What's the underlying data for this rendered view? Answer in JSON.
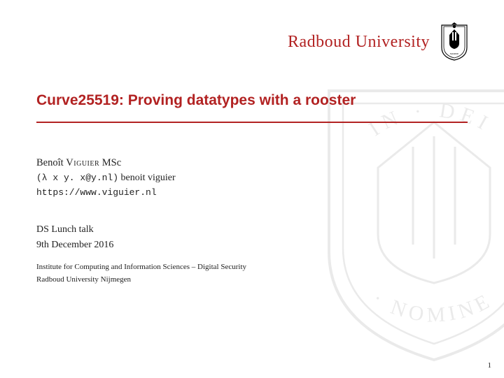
{
  "header": {
    "university": "Radboud University"
  },
  "title": "Curve25519: Proving datatypes with a rooster",
  "author": {
    "first": "Benoît",
    "surname": "Viguier",
    "degree": "MSc",
    "email_prefix": "(λ x y.  x@y.nl)",
    "email_name": "benoit viguier",
    "url": "https://www.viguier.nl"
  },
  "event": {
    "name": "DS Lunch talk",
    "date": "9th December 2016"
  },
  "affiliation": {
    "line1": "Institute for Computing and Information Sciences – Digital Security",
    "line2": "Radboud University Nijmegen"
  },
  "page": "1"
}
